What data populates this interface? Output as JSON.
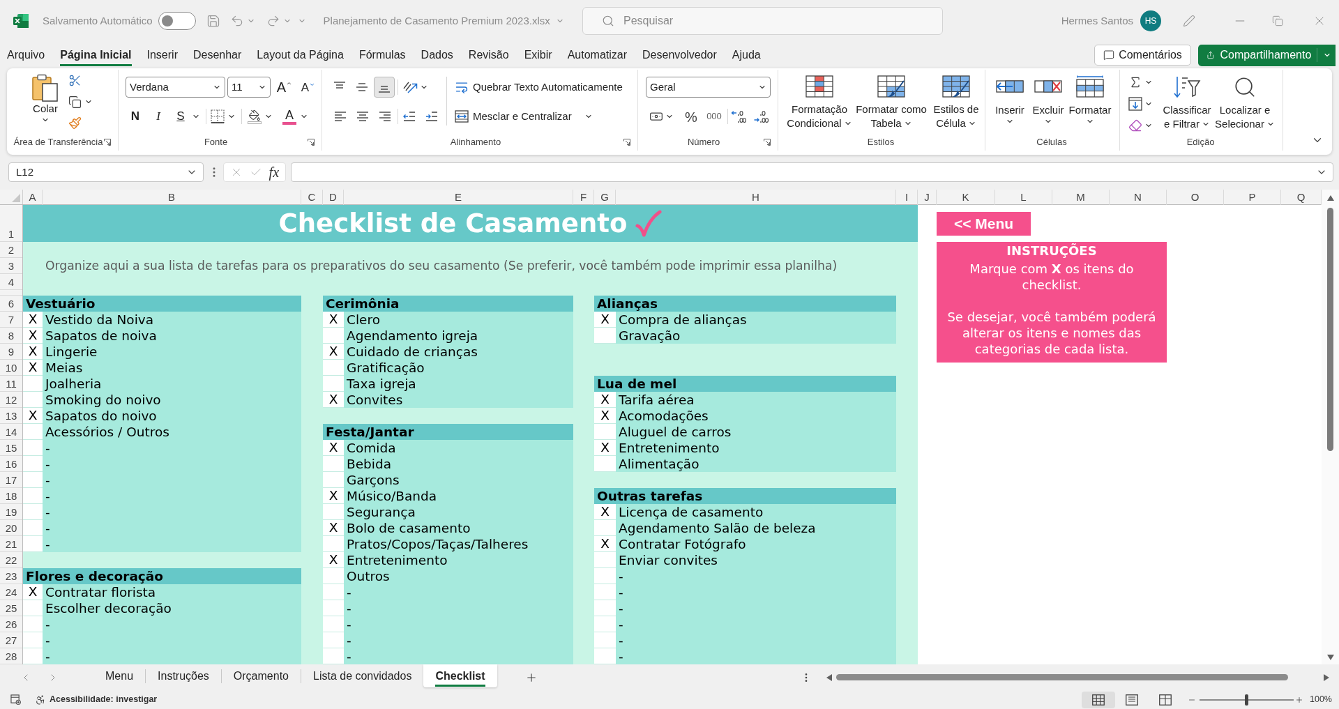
{
  "title_bar": {
    "autosave_label": "Salvamento Automático",
    "autosave_on": false,
    "file_name": "Planejamento de Casamento Premium 2023.xlsx",
    "search": {
      "placeholder": "Pesquisar"
    },
    "user_name": "Hermes Santos",
    "user_initials": "HS"
  },
  "ribbon_tabs": [
    {
      "label": "Arquivo",
      "selected": false
    },
    {
      "label": "Página Inicial",
      "selected": true
    },
    {
      "label": "Inserir",
      "selected": false
    },
    {
      "label": "Desenhar",
      "selected": false
    },
    {
      "label": "Layout da Página",
      "selected": false
    },
    {
      "label": "Fórmulas",
      "selected": false
    },
    {
      "label": "Dados",
      "selected": false
    },
    {
      "label": "Revisão",
      "selected": false
    },
    {
      "label": "Exibir",
      "selected": false
    },
    {
      "label": "Automatizar",
      "selected": false
    },
    {
      "label": "Desenvolvedor",
      "selected": false
    },
    {
      "label": "Ajuda",
      "selected": false
    }
  ],
  "header_buttons": {
    "comments": "Comentários",
    "share": "Compartilhamento"
  },
  "ribbon": {
    "clipboard": {
      "paste": "Colar",
      "group_label": "Área de Transferência"
    },
    "font": {
      "font_name": "Verdana",
      "font_size": "11",
      "grow": "A",
      "shrink": "A",
      "bold": "N",
      "italic": "I",
      "underline": "S",
      "font_color": "A",
      "group_label": "Fonte"
    },
    "alignment": {
      "vertical": [
        {
          "kind": "top",
          "selected": false
        },
        {
          "kind": "middle",
          "selected": false
        },
        {
          "kind": "bottom",
          "selected": true
        }
      ],
      "horizontal": [
        {
          "kind": "left"
        },
        {
          "kind": "center"
        },
        {
          "kind": "right"
        }
      ],
      "wrap_text": "Quebrar Texto Automaticamente",
      "merge": "Mesclar e Centralizar",
      "group_label": "Alinhamento"
    },
    "number": {
      "format": "Geral",
      "percent": "%",
      "thousands": "000",
      "group_label": "Número"
    },
    "styles": {
      "buttons": [
        {
          "kind": "conditional",
          "lines": [
            "Formatação",
            "Condicional"
          ]
        },
        {
          "kind": "table",
          "lines": [
            "Formatar como",
            "Tabela"
          ]
        },
        {
          "kind": "cell_styles",
          "lines": [
            "Estilos de",
            "Célula"
          ]
        }
      ],
      "group_label": "Estilos"
    },
    "cells": {
      "buttons": [
        {
          "kind": "insert",
          "label": "Inserir"
        },
        {
          "kind": "delete",
          "label": "Excluir"
        },
        {
          "kind": "format",
          "label": "Formatar"
        }
      ],
      "group_label": "Células"
    },
    "editing": {
      "buttons": [
        {
          "kind": "sort",
          "lines": [
            "Classificar",
            "e Filtrar"
          ]
        },
        {
          "kind": "find",
          "lines": [
            "Localizar e",
            "Selecionar"
          ]
        }
      ],
      "group_label": "Edição"
    }
  },
  "formula_bar": {
    "name_box": "L12",
    "fx": "fx"
  },
  "sheet": {
    "column_letters": [
      "A",
      "B",
      "C",
      "D",
      "E",
      "F",
      "G",
      "H",
      "I",
      "J",
      "K",
      "L",
      "M",
      "N",
      "O",
      "P",
      "Q"
    ],
    "row_numbers": [
      "1",
      "2",
      "3",
      "4",
      "6",
      "7",
      "8",
      "9",
      "10",
      "11",
      "12",
      "13",
      "14",
      "15",
      "16",
      "17",
      "18",
      "19",
      "20",
      "21",
      "22",
      "23",
      "24",
      "25",
      "26",
      "27",
      "28"
    ],
    "title": "Checklist de Casamento",
    "subtitle": "Organize aqui a sua lista de tarefas para os preparativos do seu casamento (Se preferir, você também pode imprimir essa planilha)",
    "lists": [
      {
        "sections": [
          {
            "name": "Vestuário",
            "items": [
              {
                "mark": "X",
                "label": "Vestido da Noiva"
              },
              {
                "mark": "X",
                "label": "Sapatos de noiva"
              },
              {
                "mark": "X",
                "label": "Lingerie"
              },
              {
                "mark": "X",
                "label": "Meias"
              },
              {
                "label": "Joalheria"
              },
              {
                "label": "Smoking do noivo"
              },
              {
                "mark": "X",
                "label": "Sapatos do noivo"
              },
              {
                "label": "Acessórios / Outros"
              },
              {
                "label": "-"
              },
              {
                "label": "-"
              },
              {
                "label": "-"
              },
              {
                "label": "-"
              },
              {
                "label": "-"
              },
              {
                "label": "-"
              },
              {
                "label": "-"
              }
            ]
          },
          {
            "name": "Flores e decoração",
            "items": [
              {
                "mark": "X",
                "label": "Contratar florista"
              },
              {
                "label": "Escolher decoração"
              },
              {
                "label": "-"
              },
              {
                "label": "-"
              },
              {
                "label": "-"
              }
            ]
          }
        ]
      },
      {
        "sections": [
          {
            "name": "Cerimônia",
            "items": [
              {
                "mark": "X",
                "label": "Clero"
              },
              {
                "label": "Agendamento igreja"
              },
              {
                "mark": "X",
                "label": "Cuidado de crianças"
              },
              {
                "label": "Gratificação"
              },
              {
                "label": "Taxa igreja"
              },
              {
                "mark": "X",
                "label": "Convites"
              }
            ]
          },
          {
            "name": "Festa/Jantar",
            "items": [
              {
                "mark": "X",
                "label": "Comida"
              },
              {
                "label": "Bebida"
              },
              {
                "label": "Garçons"
              },
              {
                "mark": "X",
                "label": "Músico/Banda"
              },
              {
                "label": "Segurança"
              },
              {
                "mark": "X",
                "label": "Bolo de casamento"
              },
              {
                "label": "Pratos/Copos/Taças/Talheres"
              },
              {
                "mark": "X",
                "label": "Entretenimento"
              },
              {
                "label": "Outros"
              },
              {
                "label": "-"
              },
              {
                "label": "-"
              },
              {
                "label": "-"
              },
              {
                "label": "-"
              },
              {
                "label": "-"
              }
            ]
          }
        ]
      },
      {
        "sections": [
          {
            "name": "Alianças",
            "items": [
              {
                "mark": "X",
                "label": "Compra de alianças"
              },
              {
                "label": "Gravação"
              }
            ]
          },
          {
            "name": "Lua de mel",
            "items": [
              {
                "mark": "X",
                "label": "Tarifa aérea"
              },
              {
                "mark": "X",
                "label": "Acomodações"
              },
              {
                "label": "Aluguel de carros"
              },
              {
                "mark": "X",
                "label": "Entretenimento"
              },
              {
                "label": "Alimentação"
              }
            ]
          },
          {
            "name": "Outras tarefas",
            "items": [
              {
                "mark": "X",
                "label": "Licença de casamento"
              },
              {
                "label": "Agendamento Salão de beleza"
              },
              {
                "mark": "X",
                "label": "Contratar Fotógrafo"
              },
              {
                "label": "Enviar convites"
              },
              {
                "label": "-"
              },
              {
                "label": "-"
              },
              {
                "label": "-"
              },
              {
                "label": "-"
              },
              {
                "label": "-"
              },
              {
                "label": "-"
              }
            ]
          }
        ]
      }
    ],
    "menu_button": "<< Menu",
    "instructions": {
      "heading": "INSTRUÇÕES",
      "paragraphs": [
        "Marque com **X** os itens do checklist.",
        "Se desejar, você também poderá alterar os itens e nomes das categorias de cada lista."
      ]
    }
  },
  "sheet_tabs": [
    {
      "label": "Menu",
      "selected": false
    },
    {
      "label": "Instruções",
      "selected": false
    },
    {
      "label": "Orçamento",
      "selected": false
    },
    {
      "label": "Lista de convidados",
      "selected": false
    },
    {
      "label": "Checklist",
      "selected": true
    }
  ],
  "status_bar": {
    "accessibility": "Acessibilidade: investigar",
    "views": [
      {
        "kind": "normal",
        "selected": true
      },
      {
        "kind": "page_layout",
        "selected": false
      },
      {
        "kind": "page_break",
        "selected": false
      }
    ],
    "zoom": {
      "level": 0.5,
      "reading": "100%"
    }
  }
}
